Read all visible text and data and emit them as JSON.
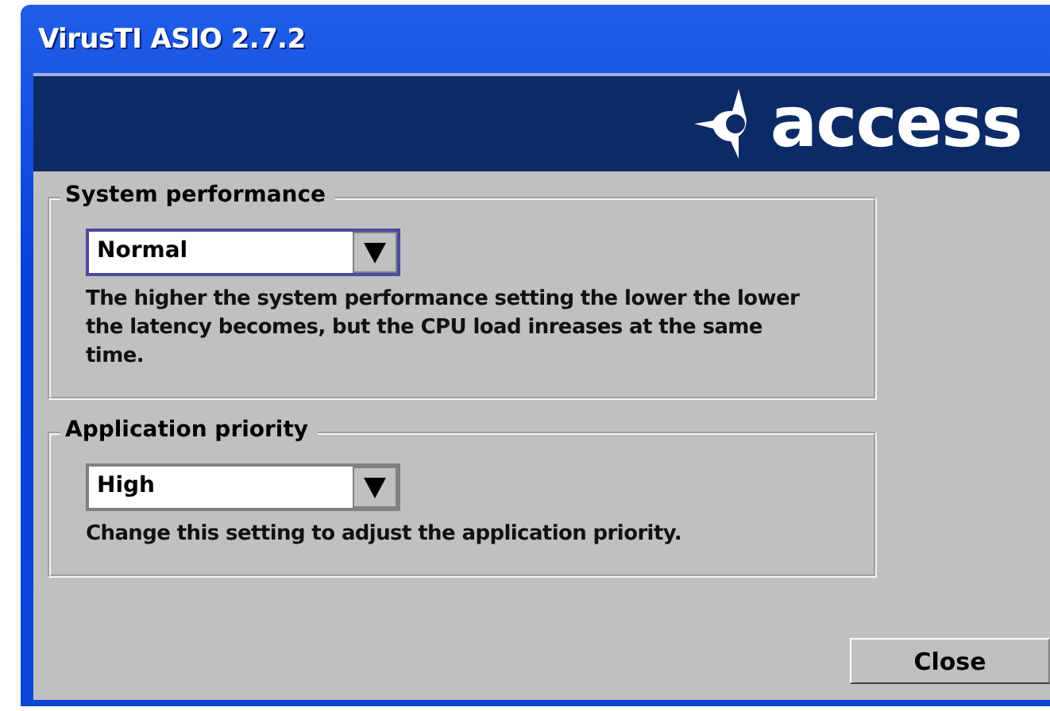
{
  "window": {
    "title": "VirusTI ASIO 2.7.2"
  },
  "banner": {
    "logo_text": "access"
  },
  "groups": [
    {
      "title": "System performance",
      "dropdown": {
        "value": "Normal",
        "focused": true
      },
      "description": "The higher the system performance setting the lower the lower the latency becomes, but the CPU load inreases at the same time."
    },
    {
      "title": "Application priority",
      "dropdown": {
        "value": "High",
        "focused": false
      },
      "description": "Change this setting to adjust the application priority."
    }
  ],
  "buttons": [
    "Close"
  ]
}
